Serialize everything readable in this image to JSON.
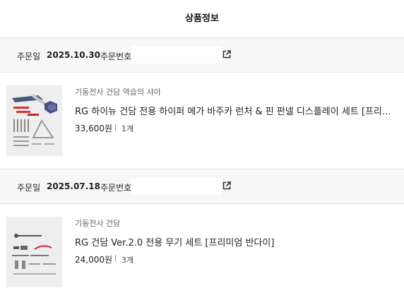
{
  "page": {
    "title": "상품정보"
  },
  "orders": [
    {
      "date_label": "주문일",
      "date": "2025.10.30",
      "number_label": "주문번호",
      "product": {
        "brand": "기동전사 건담 역습의 샤아",
        "name": "RG 하이뉴 건담 전용 하이퍼 메가 바주카 런처 & 핀 판넬 디스플레이 세트 [프리…",
        "price": "33,600원",
        "quantity": "1개"
      }
    },
    {
      "date_label": "주문일",
      "date": "2025.07.18",
      "number_label": "주문번호",
      "product": {
        "brand": "기동전사 건담",
        "name": "RG 건담 Ver.2.0 전용 무기 세트 [프리미엄 반다이]",
        "price": "24,000원",
        "quantity": "3개"
      }
    }
  ],
  "icons": {
    "order_link": "external-link-icon"
  },
  "colors": {
    "header_bg": "#f7f7f7",
    "divider": "#e3e3e3",
    "accent_red": "#e03030"
  }
}
